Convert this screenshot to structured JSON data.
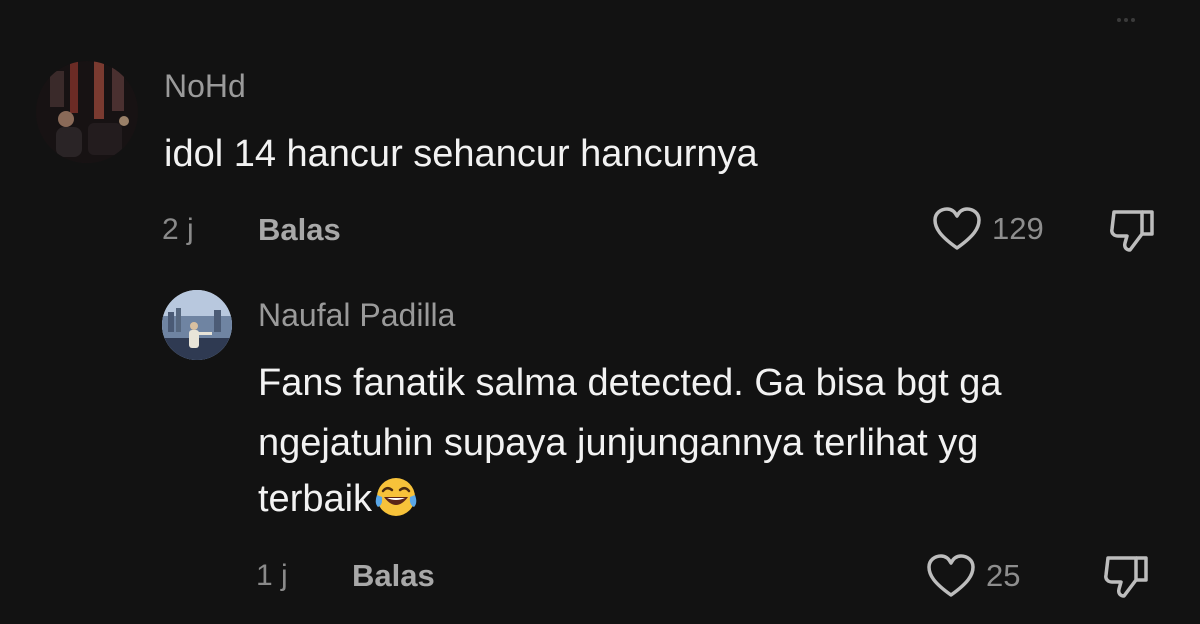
{
  "comments": [
    {
      "username": "NoHd",
      "text": "idol 14 hancur sehancur hancurnya",
      "time": "2 j",
      "reply_label": "Balas",
      "likes": "129"
    },
    {
      "username": "Naufal Padilla",
      "text_line1": "Fans fanatik salma detected. Ga bisa bgt ga",
      "text_line2": "ngejatuhin supaya junjungannya terlihat yg",
      "text_line3": "terbaik",
      "emoji": "face-with-tears-of-joy",
      "time": "1 j",
      "reply_label": "Balas",
      "likes": "25"
    }
  ],
  "colors": {
    "background": "#121212",
    "text": "#f2f2f2",
    "muted": "#8a8a8a"
  }
}
